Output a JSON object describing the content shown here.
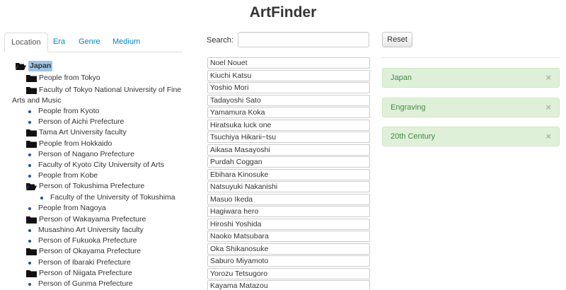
{
  "app": {
    "title": "ArtFinder"
  },
  "tabs": [
    {
      "label": "Location",
      "active": true
    },
    {
      "label": "Era",
      "active": false
    },
    {
      "label": "Genre",
      "active": false
    },
    {
      "label": "Medium",
      "active": false
    }
  ],
  "tree": {
    "root": {
      "label": "Japan",
      "icon": "folder-open-icon",
      "selected": true
    },
    "items": [
      {
        "label": "People from Tokyo",
        "icon": "folder-icon"
      },
      {
        "label": "Faculty of Tokyo National University of Fine",
        "label_cont": "Arts and Music",
        "icon": "folder-icon"
      },
      {
        "label": "People from Kyoto",
        "icon": "bullet-icon"
      },
      {
        "label": "Person of Aichi Prefecture",
        "icon": "bullet-icon"
      },
      {
        "label": "Tama Art University faculty",
        "icon": "folder-icon"
      },
      {
        "label": "People from Hokkaido",
        "icon": "folder-icon"
      },
      {
        "label": "Person of Nagano Prefecture",
        "icon": "bullet-icon"
      },
      {
        "label": "Faculty of Kyoto City University of Arts",
        "icon": "bullet-icon"
      },
      {
        "label": "People from Kobe",
        "icon": "bullet-icon"
      },
      {
        "label": "Person of Tokushima Prefecture",
        "icon": "folder-open-icon"
      },
      {
        "label": "Faculty of the University of Tokushima",
        "icon": "bullet-icon",
        "child": true
      },
      {
        "label": "People from Nagoya",
        "icon": "bullet-icon"
      },
      {
        "label": "Person of Wakayama Prefecture",
        "icon": "folder-icon"
      },
      {
        "label": "Musashino Art University faculty",
        "icon": "bullet-icon"
      },
      {
        "label": "Person of Fukuoka Prefecture",
        "icon": "bullet-icon"
      },
      {
        "label": "Person of Okayama Prefecture",
        "icon": "folder-icon"
      },
      {
        "label": "Person of Ibaraki Prefecture",
        "icon": "bullet-icon"
      },
      {
        "label": "Person of Niigata Prefecture",
        "icon": "folder-icon"
      },
      {
        "label": "Person of Gunma Prefecture",
        "icon": "bullet-icon"
      }
    ]
  },
  "search": {
    "label": "Search:",
    "value": ""
  },
  "results": [
    "Noel Nouet",
    "Kiuchi Katsu",
    "Yoshio Mori",
    "Tadayoshi Sato",
    "Yamamura Koka",
    "Hiratsuka luck one",
    "Tsuchiya Hikarii~tsu",
    "Aikasa Masayoshi",
    "Purdah Coggan",
    "Ebihara Kinosuke",
    "Natsuyuki Nakanishi",
    "Masuo Ikeda",
    "Hagiwara hero",
    "Hiroshi Yoshida",
    "Naoko Matsubara",
    "Oka Shikanosuke",
    "Saburo Miyamoto",
    "Yorozu Tetsugoro",
    "Kayama Matazou"
  ],
  "filters": {
    "reset_label": "Reset",
    "chips": [
      {
        "label": "Japan",
        "close": "×"
      },
      {
        "label": "Engraving",
        "close": "×"
      },
      {
        "label": "20th Century",
        "close": "×"
      }
    ]
  }
}
